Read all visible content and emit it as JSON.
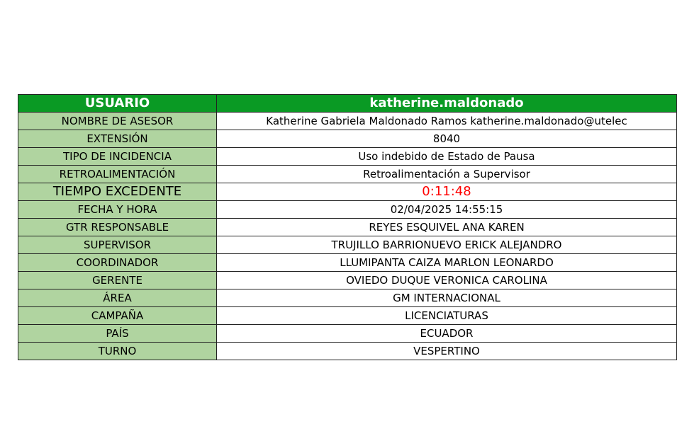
{
  "colors": {
    "header_bg": "#0a9a24",
    "header_text": "#ffffff",
    "label_bg": "#b0d4a0",
    "value_bg": "#ffffff",
    "highlight_text": "#ff0000"
  },
  "header": {
    "label": "USUARIO",
    "value": "katherine.maldonado"
  },
  "rows": [
    {
      "label": "NOMBRE DE ASESOR",
      "value": "Katherine Gabriela  Maldonado Ramos katherine.maldonado@utelec"
    },
    {
      "label": "EXTENSIÓN",
      "value": "8040"
    },
    {
      "label": "TIPO DE INCIDENCIA",
      "value": "Uso indebido de Estado de Pausa"
    },
    {
      "label": "RETROALIMENTACIÓN",
      "value": "Retroalimentación a Supervisor"
    },
    {
      "label": "TIEMPO EXCEDENTE",
      "value": "0:11:48"
    },
    {
      "label": "FECHA Y HORA",
      "value": "02/04/2025 14:55:15"
    },
    {
      "label": "GTR RESPONSABLE",
      "value": "REYES ESQUIVEL ANA KAREN"
    },
    {
      "label": "SUPERVISOR",
      "value": "TRUJILLO BARRIONUEVO ERICK ALEJANDRO"
    },
    {
      "label": "COORDINADOR",
      "value": "LLUMIPANTA CAIZA MARLON LEONARDO"
    },
    {
      "label": "GERENTE",
      "value": "OVIEDO DUQUE VERONICA CAROLINA"
    },
    {
      "label": "ÁREA",
      "value": "GM INTERNACIONAL"
    },
    {
      "label": "CAMPAÑA",
      "value": "LICENCIATURAS"
    },
    {
      "label": "PAÍS",
      "value": "ECUADOR"
    },
    {
      "label": "TURNO",
      "value": "VESPERTINO"
    }
  ]
}
